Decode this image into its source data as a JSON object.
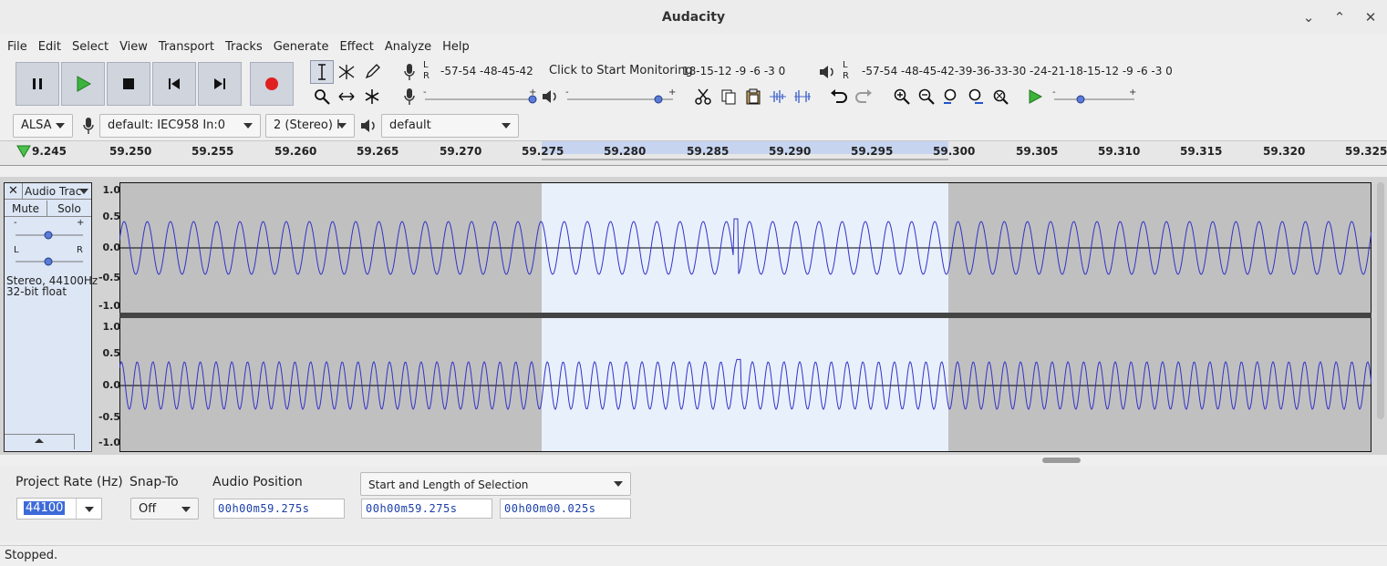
{
  "window": {
    "title": "Audacity"
  },
  "menu": [
    "File",
    "Edit",
    "Select",
    "View",
    "Transport",
    "Tracks",
    "Generate",
    "Effect",
    "Analyze",
    "Help"
  ],
  "meters": {
    "record_ticks_left": "-57-54   -48-45-42",
    "record_prompt": "Click to Start Monitoring",
    "record_ticks_right": "18-15-12  -9   -6   -3   0",
    "play_ticks": "-57-54   -48-45-42-39-36-33-30   -24-21-18-15-12  -9   -6   -3   0",
    "lr_l": "L",
    "lr_r": "R"
  },
  "devices": {
    "host": "ALSA",
    "input": "default: IEC958 In:0",
    "channels": "2 (Stereo) I",
    "output": "default"
  },
  "ruler": {
    "ticks": [
      "9.245",
      "59.250",
      "59.255",
      "59.260",
      "59.265",
      "59.270",
      "59.275",
      "59.280",
      "59.285",
      "59.290",
      "59.295",
      "59.300",
      "59.305",
      "59.310",
      "59.315",
      "59.320",
      "59.325"
    ]
  },
  "track": {
    "name": "Audio Trac",
    "mute": "Mute",
    "solo": "Solo",
    "gain_minus": "-",
    "gain_plus": "+",
    "pan_l": "L",
    "pan_r": "R",
    "info_line1": "Stereo, 44100Hz",
    "info_line2": "32-bit float",
    "scale": [
      "1.0",
      "0.5",
      "0.0",
      "-0.5",
      "-1.0"
    ]
  },
  "selectionbar": {
    "rate_label": "Project Rate (Hz)",
    "rate_value": "44100",
    "snap_label": "Snap-To",
    "snap_value": "Off",
    "pos_label": "Audio Position",
    "pos_value": "00h00m59.275s",
    "sel_mode": "Start and Length of Selection",
    "sel_start": "00h00m59.275s",
    "sel_length": "00h00m00.025s"
  },
  "status": "Stopped.",
  "colors": {
    "selection": "#e8f0fc",
    "wave": "#3232c8",
    "unselected": "#c0c0c0"
  }
}
